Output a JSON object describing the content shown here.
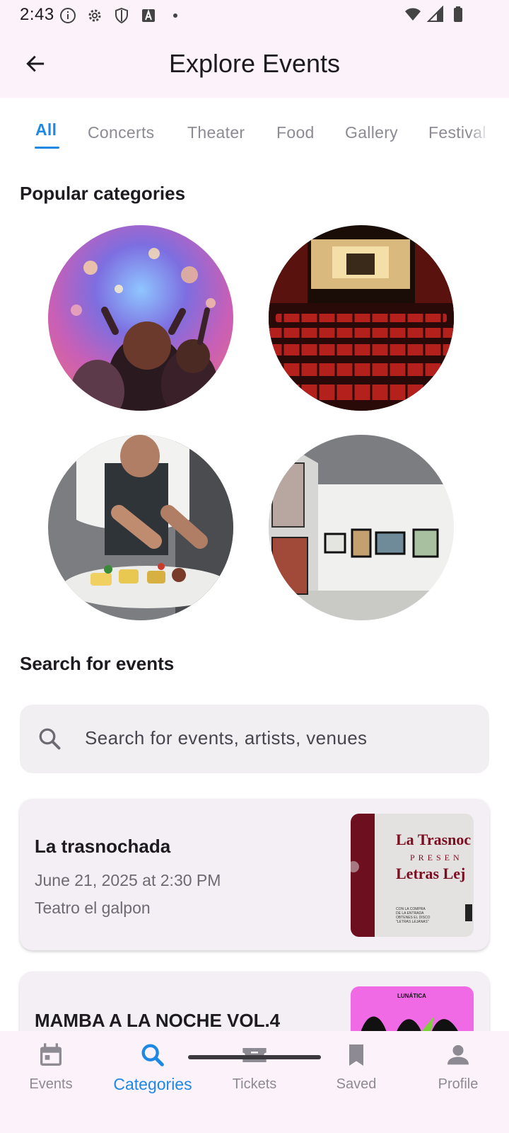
{
  "status_bar": {
    "time": "2:43"
  },
  "app_bar": {
    "title": "Explore Events"
  },
  "tabs": [
    {
      "label": "All"
    },
    {
      "label": "Concerts"
    },
    {
      "label": "Theater"
    },
    {
      "label": "Food"
    },
    {
      "label": "Gallery"
    },
    {
      "label": "Festival"
    }
  ],
  "popular": {
    "title": "Popular categories",
    "items": [
      "concerts-photo",
      "theater-photo",
      "food-photo",
      "gallery-photo"
    ]
  },
  "search": {
    "title": "Search for events",
    "placeholder": "Search for events, artists, venues"
  },
  "events": [
    {
      "name": "La trasnochada",
      "date": "June 21, 2025 at 2:30 PM",
      "venue": "Teatro el galpon",
      "poster_text": [
        "La Trasnoc",
        "PRESEN",
        "Letras Lej",
        "CON LA COMPRA",
        "DE LA ENTRADA",
        "OBTENES EL DISCO",
        "\"LETRAS LEJANAS\""
      ]
    },
    {
      "name": "MAMBA A LA NOCHE VOL.4",
      "poster_text": [
        "LUNÁTICA"
      ]
    }
  ],
  "bottom_nav": [
    {
      "label": "Events",
      "icon": "calendar-icon"
    },
    {
      "label": "Categories",
      "icon": "search-icon"
    },
    {
      "label": "Tickets",
      "icon": "ticket-icon"
    },
    {
      "label": "Saved",
      "icon": "bookmark-icon"
    },
    {
      "label": "Profile",
      "icon": "person-icon"
    }
  ],
  "colors": {
    "accent": "#1e88e5",
    "surface": "#fcf2fa",
    "card": "#f4eef5"
  }
}
